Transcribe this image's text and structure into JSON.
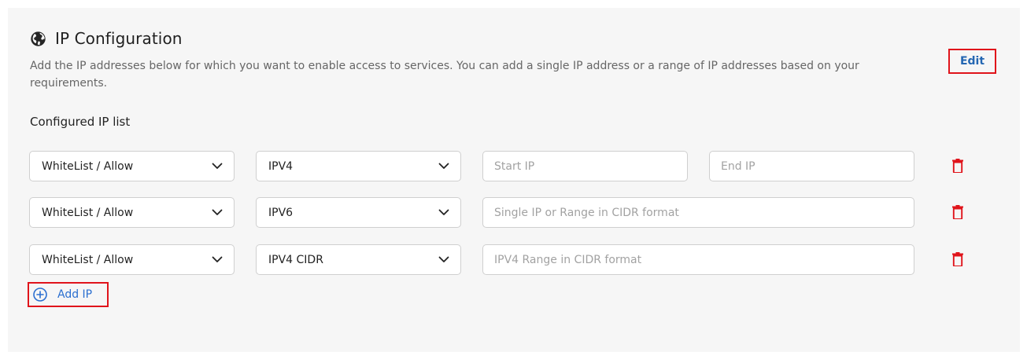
{
  "section": {
    "title": "IP Configuration",
    "description": "Add the IP addresses below for which you want to enable access to services. You can add a single IP address or a range of IP addresses based on your requirements.",
    "edit_label": "Edit",
    "list_label": "Configured IP list",
    "add_label": "Add IP"
  },
  "rows": [
    {
      "type": "WhiteList / Allow",
      "protocol": "IPV4",
      "start_placeholder": "Start IP",
      "end_placeholder": "End IP"
    },
    {
      "type": "WhiteList / Allow",
      "protocol": "IPV6",
      "placeholder": "Single IP or Range in CIDR format"
    },
    {
      "type": "WhiteList / Allow",
      "protocol": "IPV4 CIDR",
      "placeholder": "IPV4 Range in CIDR format"
    }
  ],
  "icons": {
    "header": "globe-icon",
    "dropdown": "chevron-down-icon",
    "delete": "trash-icon",
    "add": "plus-circle-icon"
  },
  "colors": {
    "delete": "#e0141b",
    "link": "#2b6fd0",
    "edit_text": "#2466b2",
    "highlight_border": "#e0141b",
    "panel_bg": "#f6f6f6"
  }
}
